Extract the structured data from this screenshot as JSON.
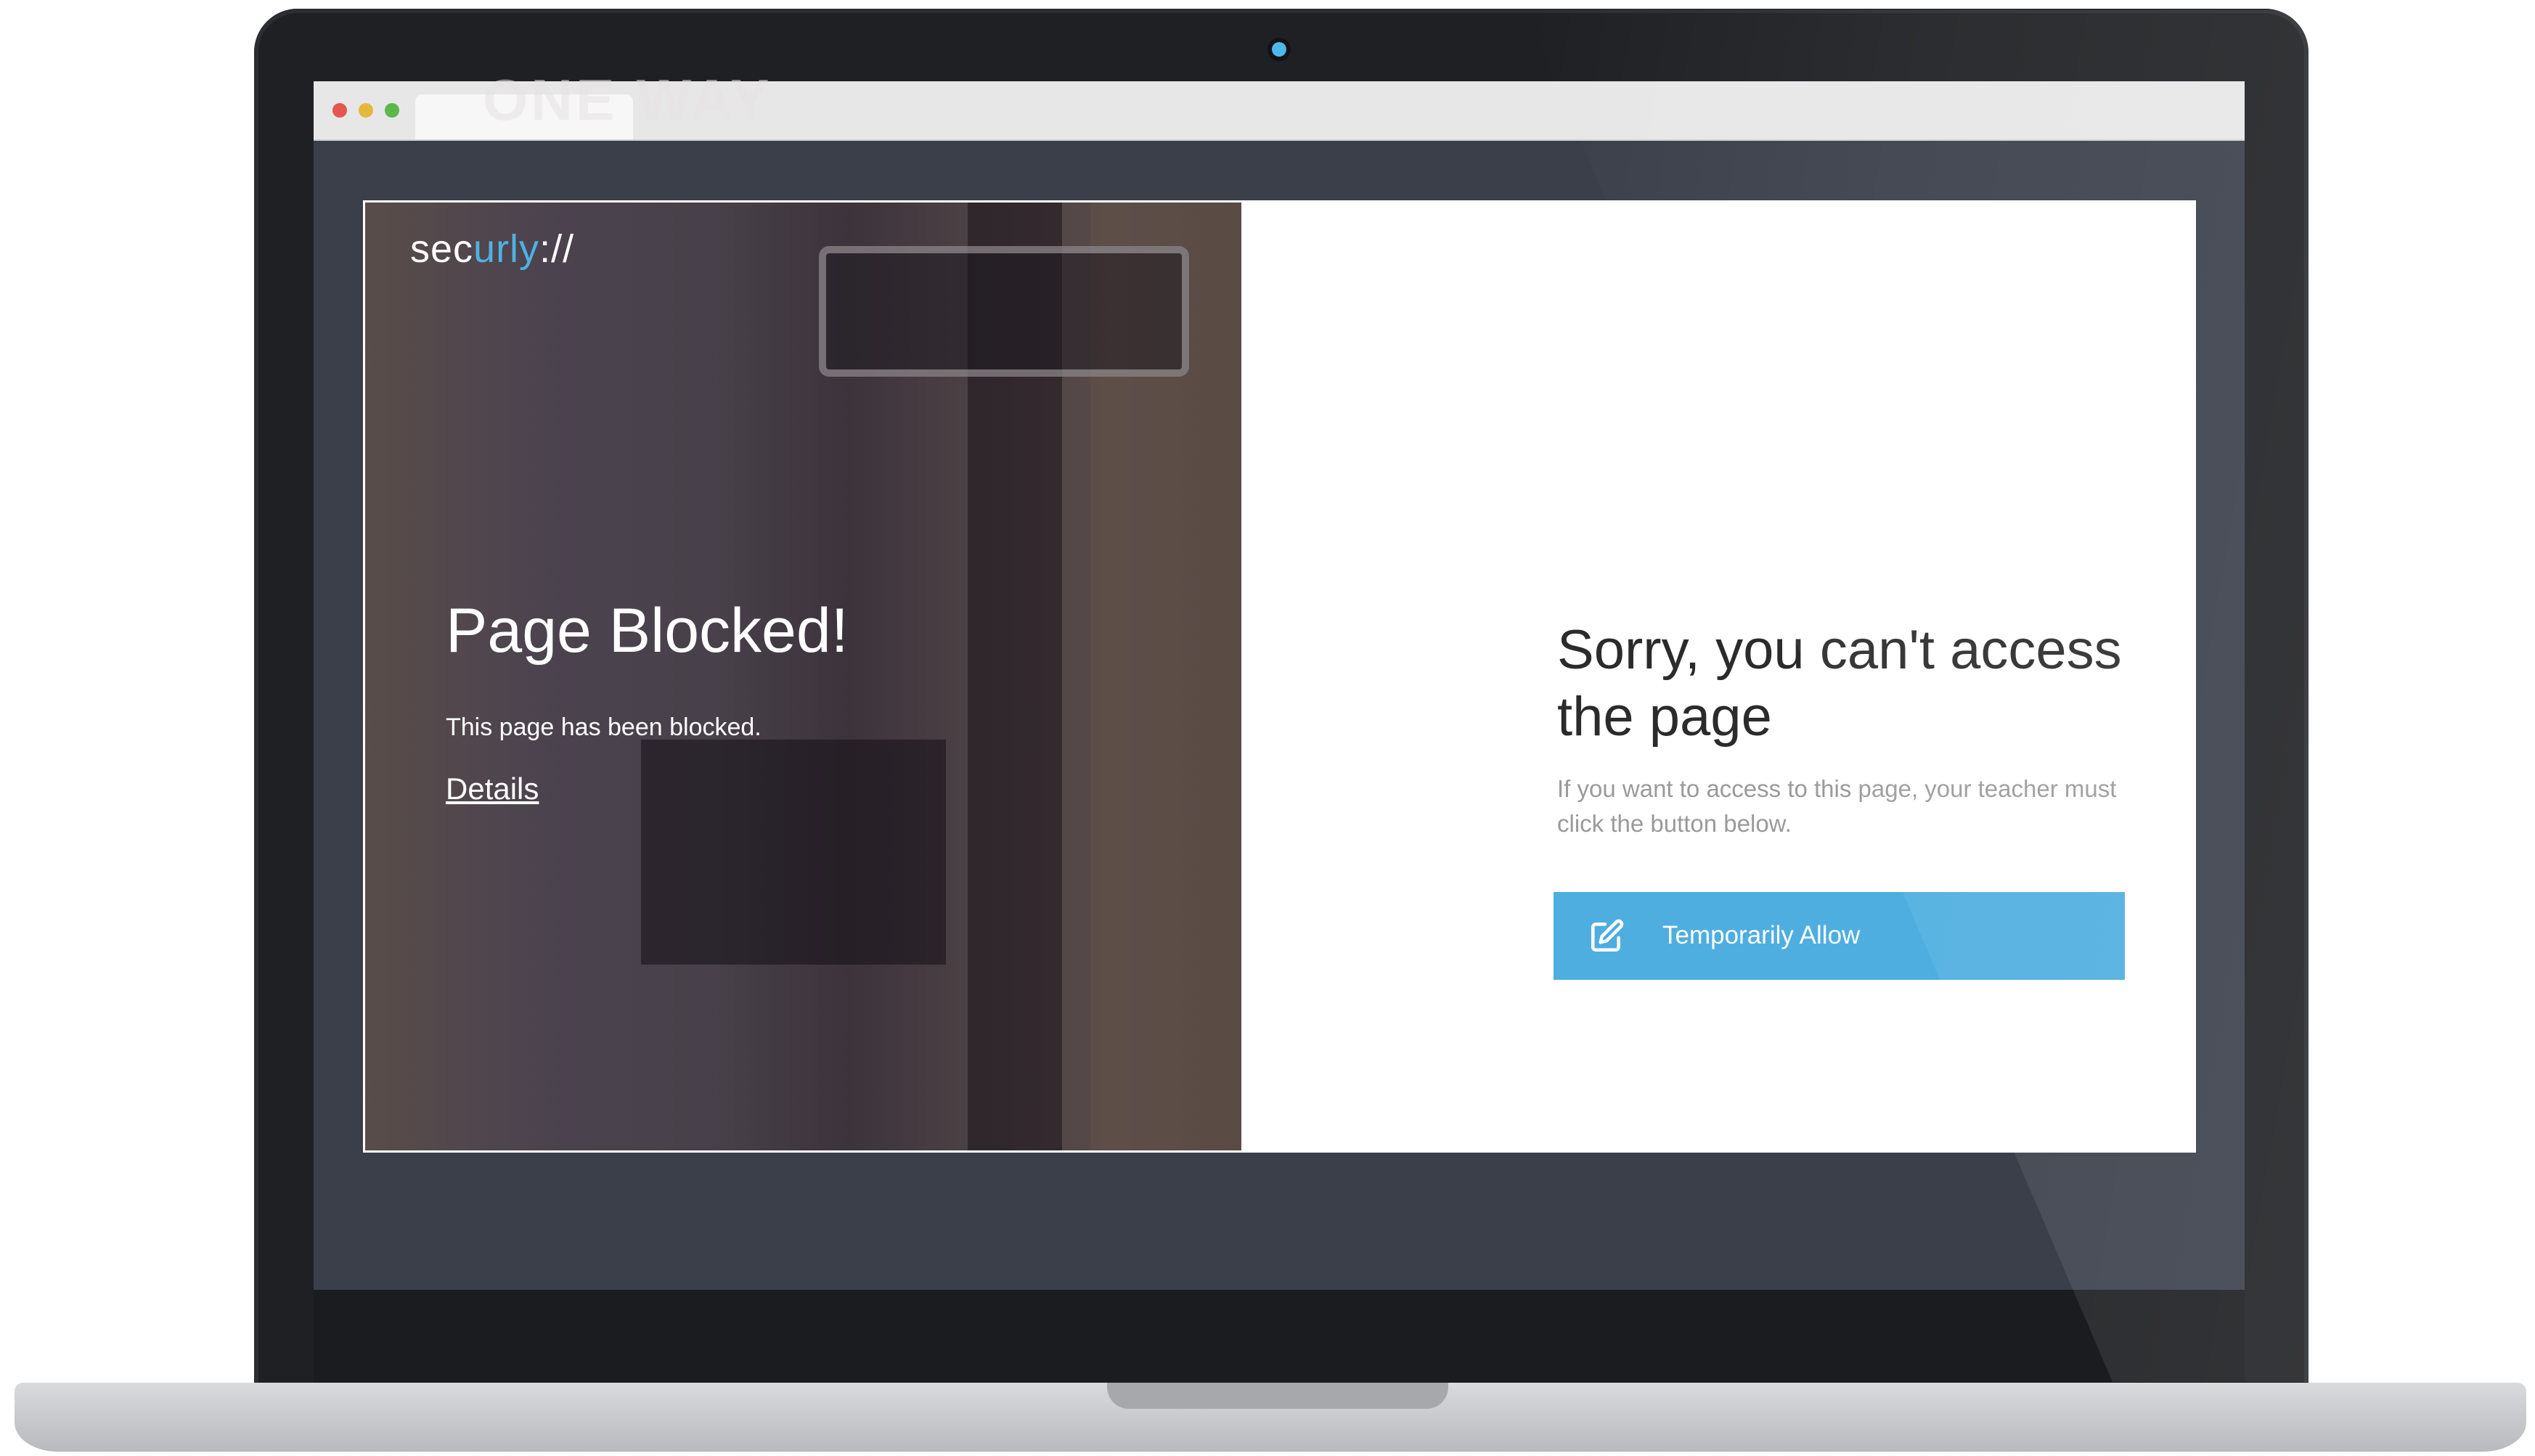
{
  "logo": {
    "prefix": "sec",
    "accent": "urly",
    "suffix": "://"
  },
  "left_panel": {
    "background_sign_text": "ONE WAY",
    "title": "Page Blocked!",
    "description": "This page has been blocked.",
    "details_link": "Details"
  },
  "right_panel": {
    "title": "Sorry, you can't access the page",
    "description": "If you want to access to this page, your teacher must click the button below.",
    "button_label": "Temporarily Allow",
    "button_icon": "edit-icon"
  },
  "colors": {
    "accent": "#4eaee0",
    "logo_accent": "#4fb0e2",
    "panel_overlay": "#3e3440",
    "title_text": "#2b2b2b",
    "muted_text": "#9a9a9a"
  }
}
